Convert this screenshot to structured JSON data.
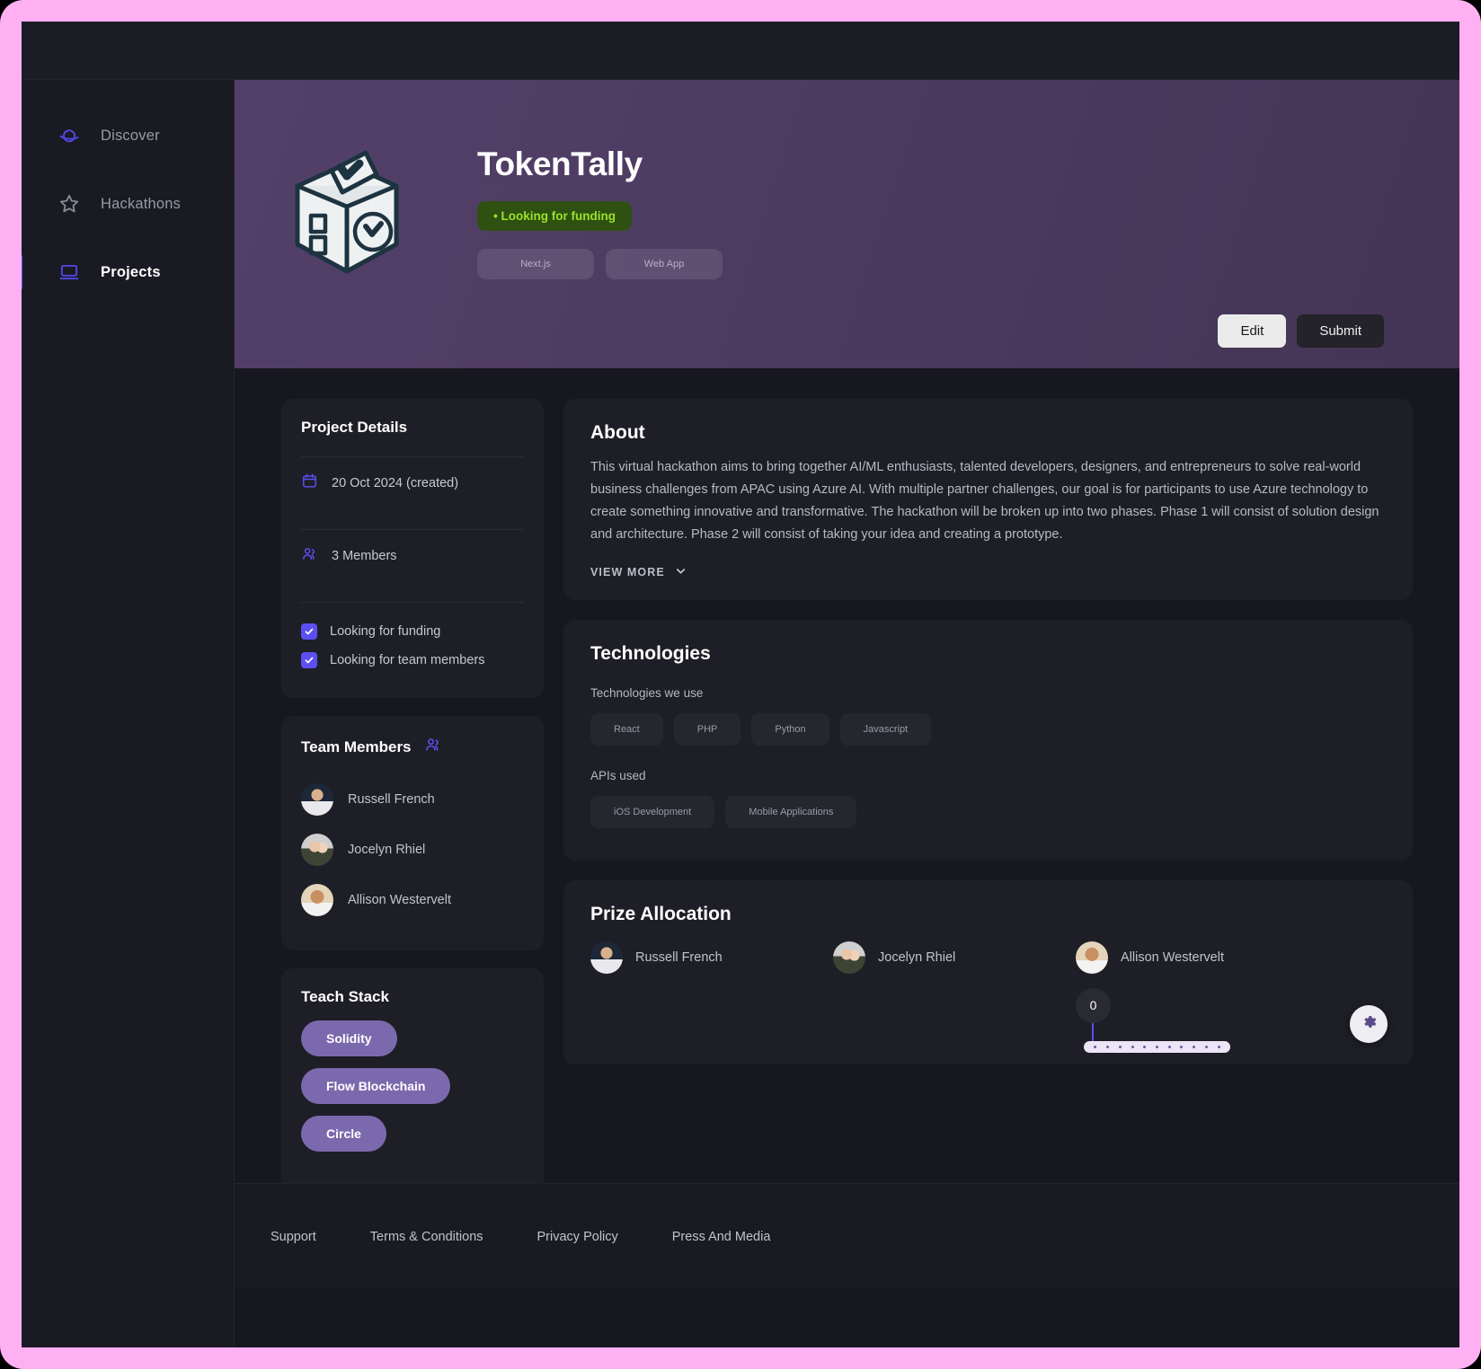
{
  "frame": {
    "accent_pink": "#FFB0F2",
    "app_bg": "#17171f"
  },
  "sidebar": {
    "items": [
      {
        "label": "Discover",
        "icon": "planet-icon",
        "active": false
      },
      {
        "label": "Hackathons",
        "icon": "star-icon",
        "active": false
      },
      {
        "label": "Projects",
        "icon": "laptop-icon",
        "active": true
      }
    ]
  },
  "hero": {
    "logo_icon": "ballot-box-check-icon",
    "title": "TokenTally",
    "badge": "• Looking for funding",
    "badge_color": "#9ae12e",
    "badge_bg": "#2e5010",
    "tags": [
      "Next.js",
      "Web App"
    ],
    "edit_label": "Edit",
    "submit_label": "Submit"
  },
  "details": {
    "title": "Project Details",
    "date_icon": "calendar-icon",
    "date": "20 Oct 2024 (created)",
    "members_icon": "users-icon",
    "members": "3 Members",
    "checks": [
      {
        "label": "Looking for funding",
        "checked": true
      },
      {
        "label": "Looking for team members",
        "checked": true
      }
    ],
    "check_color": "#5c4ff1"
  },
  "team": {
    "title": "Team Members",
    "icon": "users-icon",
    "members": [
      "Russell French",
      "Jocelyn Rhiel",
      "Allison Westervelt"
    ]
  },
  "stack": {
    "title": "Teach Stack",
    "chips": [
      "Solidity",
      "Flow Blockchain",
      "Circle"
    ],
    "chip_color": "#7b69ad"
  },
  "about": {
    "title": "About",
    "text": "This virtual hackathon aims to bring together AI/ML enthusiasts, talented developers, designers, and entrepreneurs to solve real-world business challenges from APAC using Azure AI. With multiple partner challenges, our goal is for participants to use Azure technology to create something innovative and transformative. The hackathon will be broken up into two phases. Phase 1 will consist of solution design and architecture. Phase 2 will consist of taking your idea and creating a prototype.",
    "view_more": "VIEW MORE",
    "chevron_icon": "chevron-down-icon"
  },
  "technologies": {
    "title": "Technologies",
    "tech_label": "Technologies we use",
    "tech_chips": [
      "React",
      "PHP",
      "Python",
      "Javascript"
    ],
    "apis_label": "APIs used",
    "api_chips": [
      "iOS Development",
      "Mobile Applications"
    ]
  },
  "prize": {
    "title": "Prize Allocation",
    "people": [
      {
        "name": "Russell French",
        "value": null
      },
      {
        "name": "Jocelyn Rhiel",
        "value": null
      },
      {
        "name": "Allison Westervelt",
        "value": "0"
      }
    ],
    "slider_dots": 11,
    "settings_icon": "gear-icon"
  },
  "footer": {
    "links": [
      "Support",
      "Terms & Conditions",
      "Privacy Policy",
      "Press And Media"
    ]
  }
}
